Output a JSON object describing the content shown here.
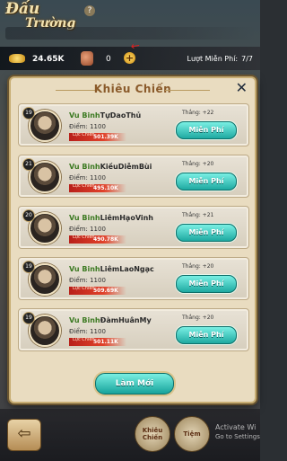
{
  "background": {
    "title_line1": "Đấu",
    "title_line2": "Trường",
    "help": "?",
    "ghost_value": "24.65K"
  },
  "top_bar": {
    "gold": "24.65K",
    "tickets": "0",
    "add": "+",
    "free_turns_label": "Lượt Miễn Phí:",
    "free_turns_value": "7/7"
  },
  "modal": {
    "title": "Khiêu Chiến",
    "close": "✕",
    "refresh_label": "Làm Mới"
  },
  "opponents": [
    {
      "level": "19",
      "rank": "Vu Binh",
      "name": "TựDaoThủ",
      "points": "Điểm: 1100",
      "power_label": "Lực\nChiến",
      "power": "501.39K",
      "win": "Thắng: +22",
      "button": "Miễn Phí"
    },
    {
      "level": "21",
      "rank": "Vu Binh",
      "name": "KiềuDiễmBùi",
      "points": "Điểm: 1100",
      "power_label": "Lực\nChiến",
      "power": "495.10K",
      "win": "Thắng: +20",
      "button": "Miễn Phí"
    },
    {
      "level": "20",
      "rank": "Vu Binh",
      "name": "LiêmHạoVinh",
      "points": "Điểm: 1100",
      "power_label": "Lực\nChiến",
      "power": "490.78K",
      "win": "Thắng: +21",
      "button": "Miễn Phí"
    },
    {
      "level": "19",
      "rank": "Vu Binh",
      "name": "LiêmLaoNgạc",
      "points": "Điểm: 1100",
      "power_label": "Lực\nChiến",
      "power": "509.69K",
      "win": "Thắng: +20",
      "button": "Miễn Phí"
    },
    {
      "level": "19",
      "rank": "Vu Binh",
      "name": "ĐàmHuânMy",
      "points": "Điểm: 1100",
      "power_label": "Lực\nChiến",
      "power": "501.11K",
      "win": "Thắng: +20",
      "button": "Miễn Phí"
    }
  ],
  "bottom": {
    "back": "⇦",
    "btn1": "Khiêu Chiến",
    "btn2": "Tiệm",
    "activate_line1": "Activate Wi",
    "activate_line2": "Go to Settings"
  },
  "colors": {
    "accent": "#1ea9a1",
    "power_bar": "#c9281f",
    "rank_green": "#3c7a22"
  }
}
